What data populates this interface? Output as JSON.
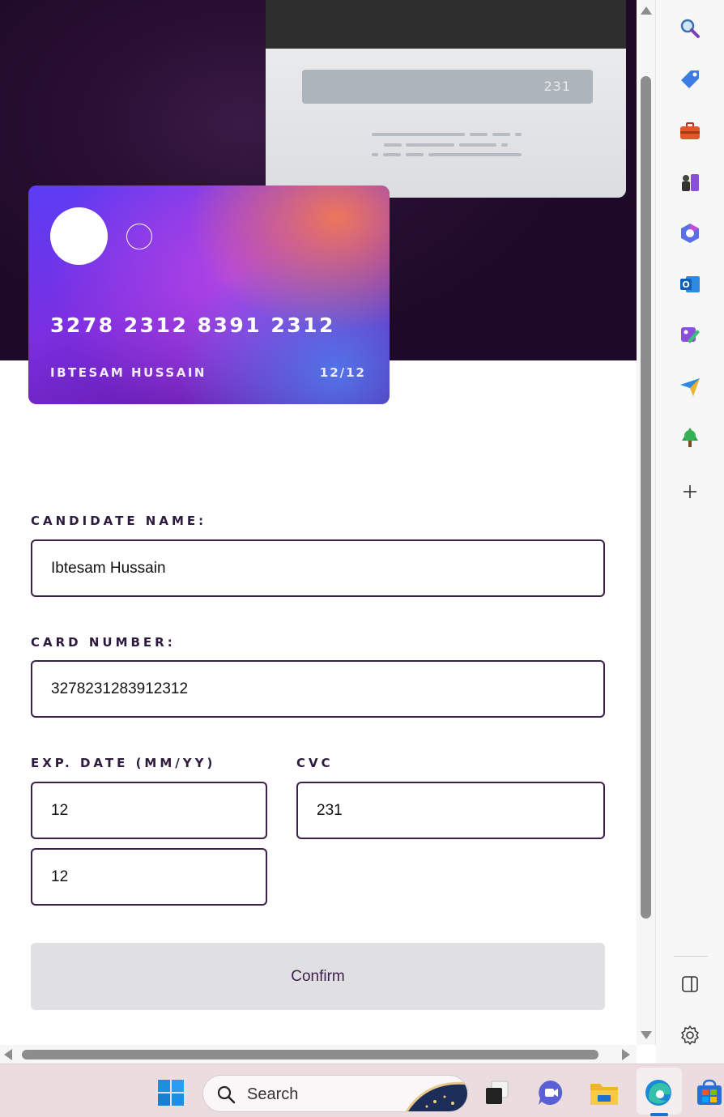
{
  "card": {
    "back_cvc": "231",
    "number": "3278 2312 8391 2312",
    "holder": "IBTESAM HUSSAIN",
    "expiry": "12/12"
  },
  "form": {
    "name_label": "CANDIDATE NAME:",
    "name_value": "Ibtesam Hussain",
    "number_label": "CARD NUMBER:",
    "number_value": "3278231283912312",
    "exp_label": "EXP. DATE (MM/YY)",
    "exp_month_value": "12",
    "exp_year_value": "12",
    "cvc_label": "CVC",
    "cvc_value": "231",
    "confirm_label": "Confirm"
  },
  "sidebar": {
    "icons": [
      "search-icon",
      "shopping-tag-icon",
      "tools-icon",
      "games-icon",
      "microsoft-365-icon",
      "outlook-icon",
      "designer-icon",
      "send-icon",
      "tree-icon",
      "add-icon",
      "split-panel-icon",
      "settings-icon"
    ]
  },
  "taskbar": {
    "search_label": "Search",
    "icons": [
      "windows-start-icon",
      "task-view-icon",
      "meet-icon",
      "file-explorer-icon",
      "edge-icon",
      "store-icon"
    ]
  },
  "colors": {
    "hero_bg": "#2a0f33",
    "label_text": "#2d1a3e",
    "field_border": "#3b2048",
    "confirm_bg": "#e0e0e2",
    "confirm_text": "#3b1e4e",
    "taskbar_bg": "#eadcdf"
  }
}
